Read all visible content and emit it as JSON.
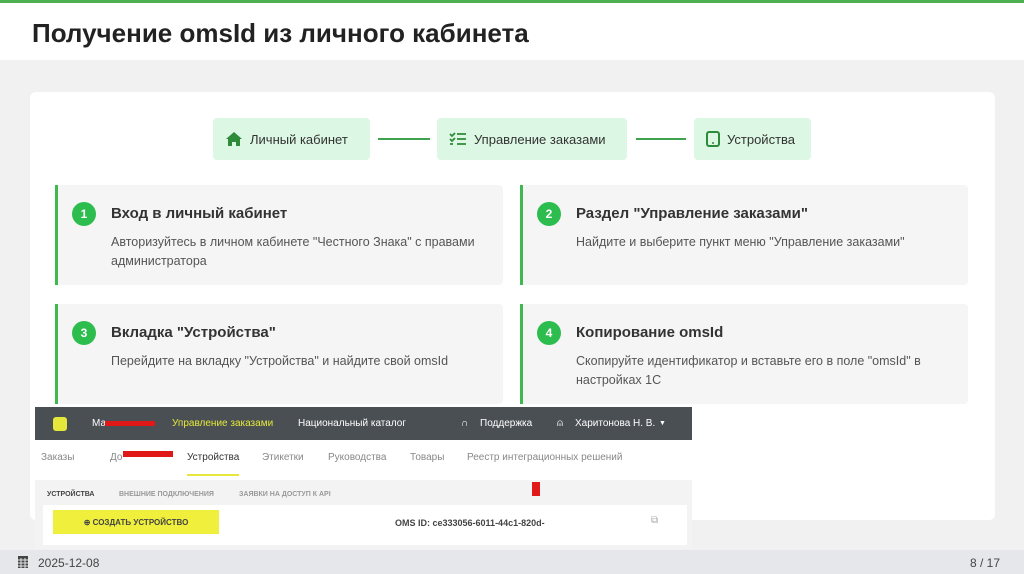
{
  "title": "Получение omsId из личного кабинета",
  "flow": [
    {
      "label": "Личный кабинет",
      "icon": "home-icon"
    },
    {
      "label": "Управление заказами",
      "icon": "checklist-icon"
    },
    {
      "label": "Устройства",
      "icon": "tablet-icon"
    }
  ],
  "steps": [
    {
      "num": "1",
      "title": "Вход в личный кабинет",
      "desc": "Авторизуйтесь в личном кабинете \"Честного Знака\" с правами администратора"
    },
    {
      "num": "2",
      "title": "Раздел \"Управление заказами\"",
      "desc": "Найдите и выберите пункт меню \"Управление заказами\""
    },
    {
      "num": "3",
      "title": "Вкладка \"Устройства\"",
      "desc": "Перейдите на вкладку \"Устройства\" и найдите свой omsId"
    },
    {
      "num": "4",
      "title": "Копирование omsId",
      "desc": "Скопируйте идентификатор и вставьте его в поле \"omsId\" в настройках 1С"
    }
  ],
  "screenshot": {
    "topnav": [
      "Ма",
      "Управление заказами",
      "Национальный каталог",
      "Поддержка",
      "Харитонова Н. В."
    ],
    "tabs": [
      "Заказы",
      "До",
      "Устройства",
      "Этикетки",
      "Руководства",
      "Товары",
      "Реестр интеграционных решений"
    ],
    "subtabs": [
      "УСТРОЙСТВА",
      "ВНЕШНИЕ ПОДКЛЮЧЕНИЯ",
      "ЗАЯВКИ НА ДОСТУП К API"
    ],
    "create_button": "СОЗДАТЬ УСТРОЙСТВО",
    "oms_id": "OMS ID: ce333056-6011-44c1-820d-"
  },
  "footer": {
    "date": "2025-12-08",
    "page": "8 / 17"
  },
  "colors": {
    "accent": "#3fb84f",
    "pill_bg": "#dcf7e3",
    "highlight": "#f0f03c",
    "arrow": "#e01818"
  }
}
